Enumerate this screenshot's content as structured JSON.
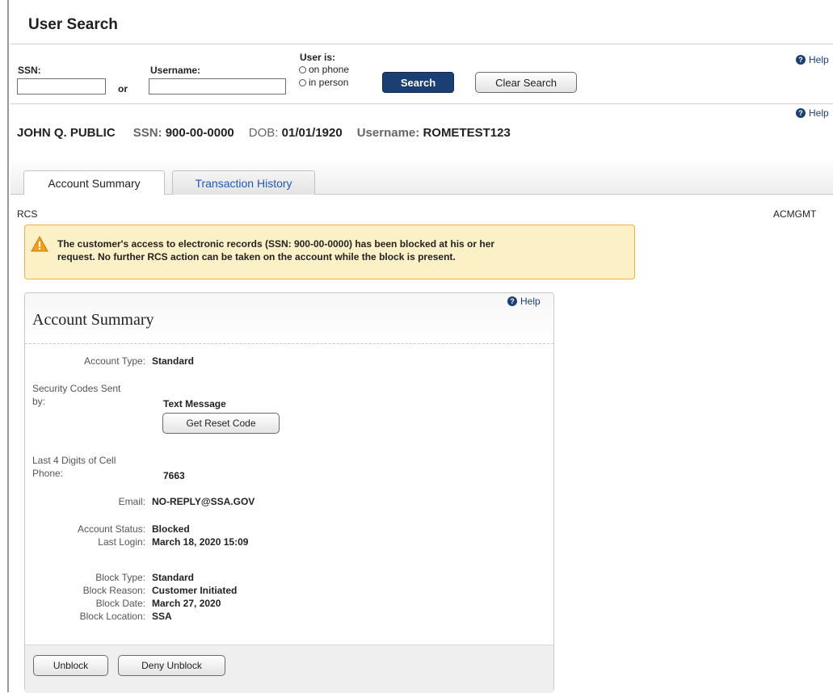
{
  "title": "User Search",
  "search": {
    "ssn_label": "SSN:",
    "or_label": "or",
    "username_label": "Username:",
    "user_is_label": "User is:",
    "option_phone": "on phone",
    "option_person": "in person",
    "search_button": "Search",
    "clear_button": "Clear Search",
    "ssn_value": "",
    "username_value": ""
  },
  "help_label": "Help",
  "user": {
    "name": "JOHN Q. PUBLIC",
    "ssn_key": "SSN:",
    "ssn_value": "900-00-0000",
    "dob_key": "DOB:",
    "dob_value": "01/01/1920",
    "username_key": "Username:",
    "username_value": "ROMETEST123"
  },
  "tabs": [
    {
      "label": "Account Summary",
      "active": true
    },
    {
      "label": "Transaction History",
      "active": false
    }
  ],
  "left_code": "RCS",
  "right_code": "ACMGMT",
  "warning": {
    "icon": "warning-triangle-icon",
    "line1": "The customer's access to electronic records (SSN: 900-00-0000) has been blocked at his or her",
    "line2": "request. No further RCS action can be taken on the account while the block is present."
  },
  "panel": {
    "title": "Account Summary",
    "help": "Help",
    "account_type_label": "Account Type:",
    "account_type_value": "Standard",
    "sec_codes_label_1": "Security Codes Sent",
    "sec_codes_label_2": "by:",
    "sec_codes_value": "Text Message",
    "get_reset_button": "Get Reset Code",
    "cell_label_1": "Last 4 Digits of Cell",
    "cell_label_2": "Phone:",
    "cell_value": "7663",
    "email_label": "Email:",
    "email_value": "NO-REPLY@SSA.GOV",
    "status_label": "Account Status:",
    "status_value": "Blocked",
    "last_login_label": "Last Login:",
    "last_login_value": "March 18, 2020 15:09",
    "block_type_label": "Block Type:",
    "block_type_value": "Standard",
    "block_reason_label": "Block Reason:",
    "block_reason_value": "Customer Initiated",
    "block_date_label": "Block Date:",
    "block_date_value": "March 27, 2020",
    "block_location_label": "Block Location:",
    "block_location_value": "SSA",
    "unblock_button": "Unblock",
    "deny_unblock_button": "Deny Unblock"
  },
  "colors": {
    "primary": "#1b3f73",
    "link": "#1f58b8",
    "warning_bg": "#fcf0c6",
    "warning_border": "#e6b43f"
  }
}
